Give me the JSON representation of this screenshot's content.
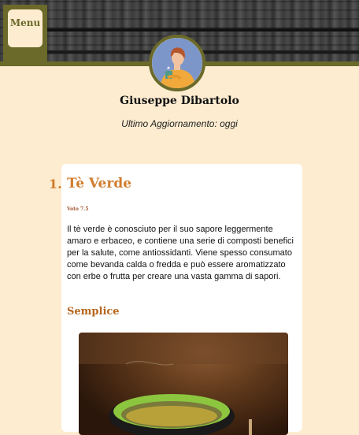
{
  "header": {
    "menu_label": "Menu"
  },
  "profile": {
    "name": "Giuseppe Dibartolo",
    "updated": "Ultimo Aggiornamento: oggi"
  },
  "article": {
    "number": "1.",
    "title": "Tè Verde",
    "rating": "Voto 7.5",
    "description": "Il tè verde è conosciuto per il suo sapore leggermente amaro e erbaceo, e contiene una serie di composti benefici per la salute, come antiossidanti. Viene spesso consumato come bevanda calda o fredda e può essere aromatizzato con erbe o frutta per creare una vasta gamma di sapori.",
    "subtitle": "Semplice"
  },
  "colors": {
    "accent": "#d17d2e",
    "frame": "#6b6a2a",
    "background": "#fdecd0"
  }
}
